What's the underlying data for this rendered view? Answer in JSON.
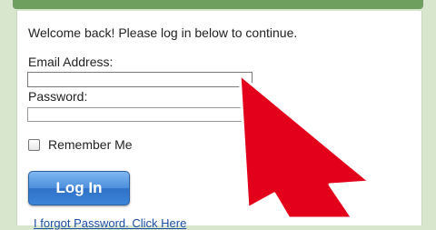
{
  "login": {
    "welcome_text": "Welcome back! Please log in below to continue.",
    "email_label": "Email Address:",
    "email_value": "",
    "password_label": "Password:",
    "password_value": "",
    "remember_label": "Remember Me",
    "remember_checked": false,
    "login_button": "Log In",
    "forgot_link": "I forgot Password. Click Here"
  },
  "colors": {
    "frame_green": "#d7e6cd",
    "header_green": "#6f9f5f",
    "button_blue": "#3c84d8",
    "arrow_red": "#e2001a"
  },
  "overlay": {
    "icon": "red-pointer-arrow-icon"
  }
}
